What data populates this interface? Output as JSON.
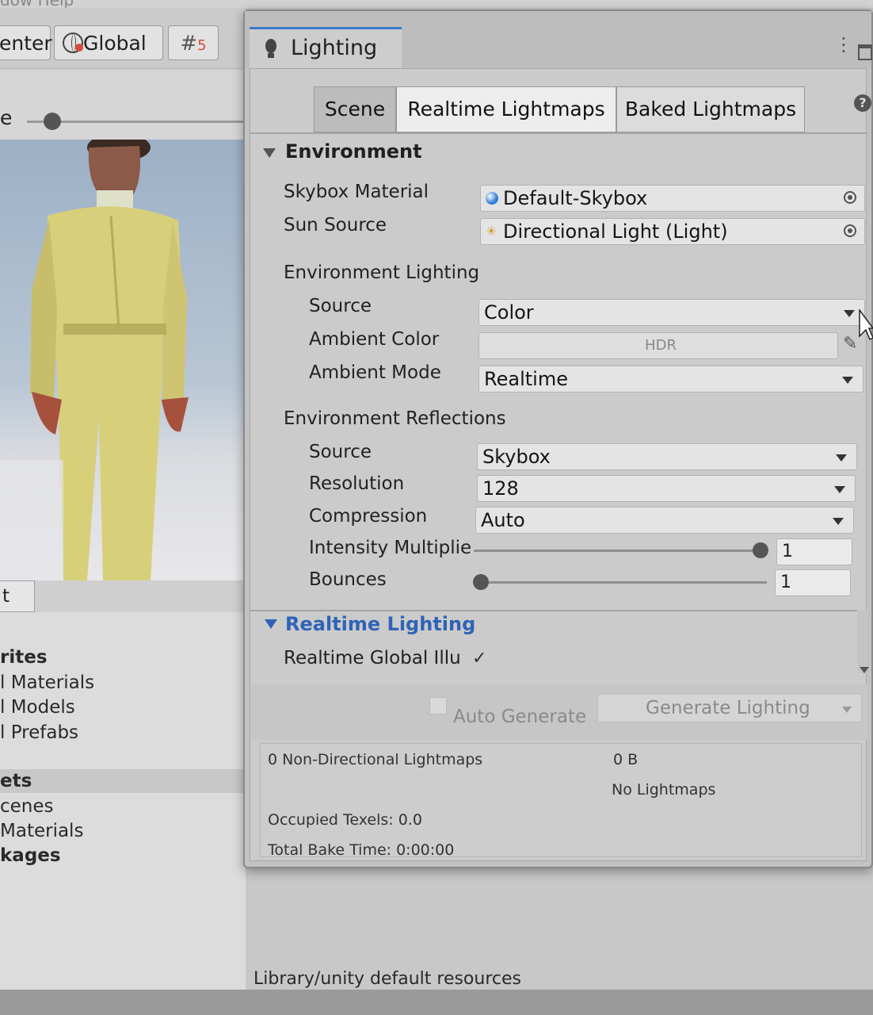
{
  "menubar": {
    "text": "dow   Help"
  },
  "toolbar": {
    "center_label": "enter",
    "global_label": "Global",
    "snap_icon": "grid-snap-icon"
  },
  "project": {
    "tab_label": "t",
    "items": [
      {
        "label": "rites",
        "bold": true
      },
      {
        "label": "l Materials",
        "bold": false
      },
      {
        "label": "l Models",
        "bold": false
      },
      {
        "label": "l Prefabs",
        "bold": false
      },
      {
        "label": "ets",
        "bold": true
      },
      {
        "label": "cenes",
        "bold": false
      },
      {
        "label": " Materials",
        "bold": false
      },
      {
        "label": "kages",
        "bold": true
      }
    ]
  },
  "scene_header": {
    "slider_label": "e"
  },
  "status": {
    "path": "Library/unity default resources"
  },
  "lighting": {
    "title": "Lighting",
    "subtabs": [
      "Scene",
      "Realtime Lightmaps",
      "Baked Lightmaps"
    ],
    "help_label": "?",
    "environment": {
      "title": "Environment",
      "skybox_material_label": "Skybox Material",
      "skybox_material_value": "Default-Skybox",
      "sun_source_label": "Sun Source",
      "sun_source_value": "Directional Light (Light)",
      "env_lighting_title": "Environment Lighting",
      "source_label": "Source",
      "source_value": "Color",
      "ambient_color_label": "Ambient Color",
      "ambient_color_value": "HDR",
      "ambient_mode_label": "Ambient Mode",
      "ambient_mode_value": "Realtime",
      "env_reflections_title": "Environment Reflections",
      "refl_source_label": "Source",
      "refl_source_value": "Skybox",
      "resolution_label": "Resolution",
      "resolution_value": "128",
      "compression_label": "Compression",
      "compression_value": "Auto",
      "intensity_label": "Intensity Multiplie",
      "intensity_value": "1",
      "intensity_fraction": 1.0,
      "bounces_label": "Bounces",
      "bounces_value": "1",
      "bounces_fraction": 0.0
    },
    "realtime": {
      "title": "Realtime Lighting",
      "gi_label": "Realtime Global Illu",
      "gi_checked": "✓"
    },
    "footer": {
      "auto_generate_label": "Auto Generate",
      "generate_button_label": "Generate Lighting",
      "lightmaps_stat": "0 Non-Directional Lightmaps",
      "size_stat": "0 B",
      "no_lightmaps": "No Lightmaps",
      "occupied_texels": "Occupied Texels: 0.0",
      "total_bake_time": "Total Bake Time: 0:00:00"
    }
  },
  "colors": {
    "accent": "#3a79c9",
    "section_blue": "#2f63b8"
  }
}
